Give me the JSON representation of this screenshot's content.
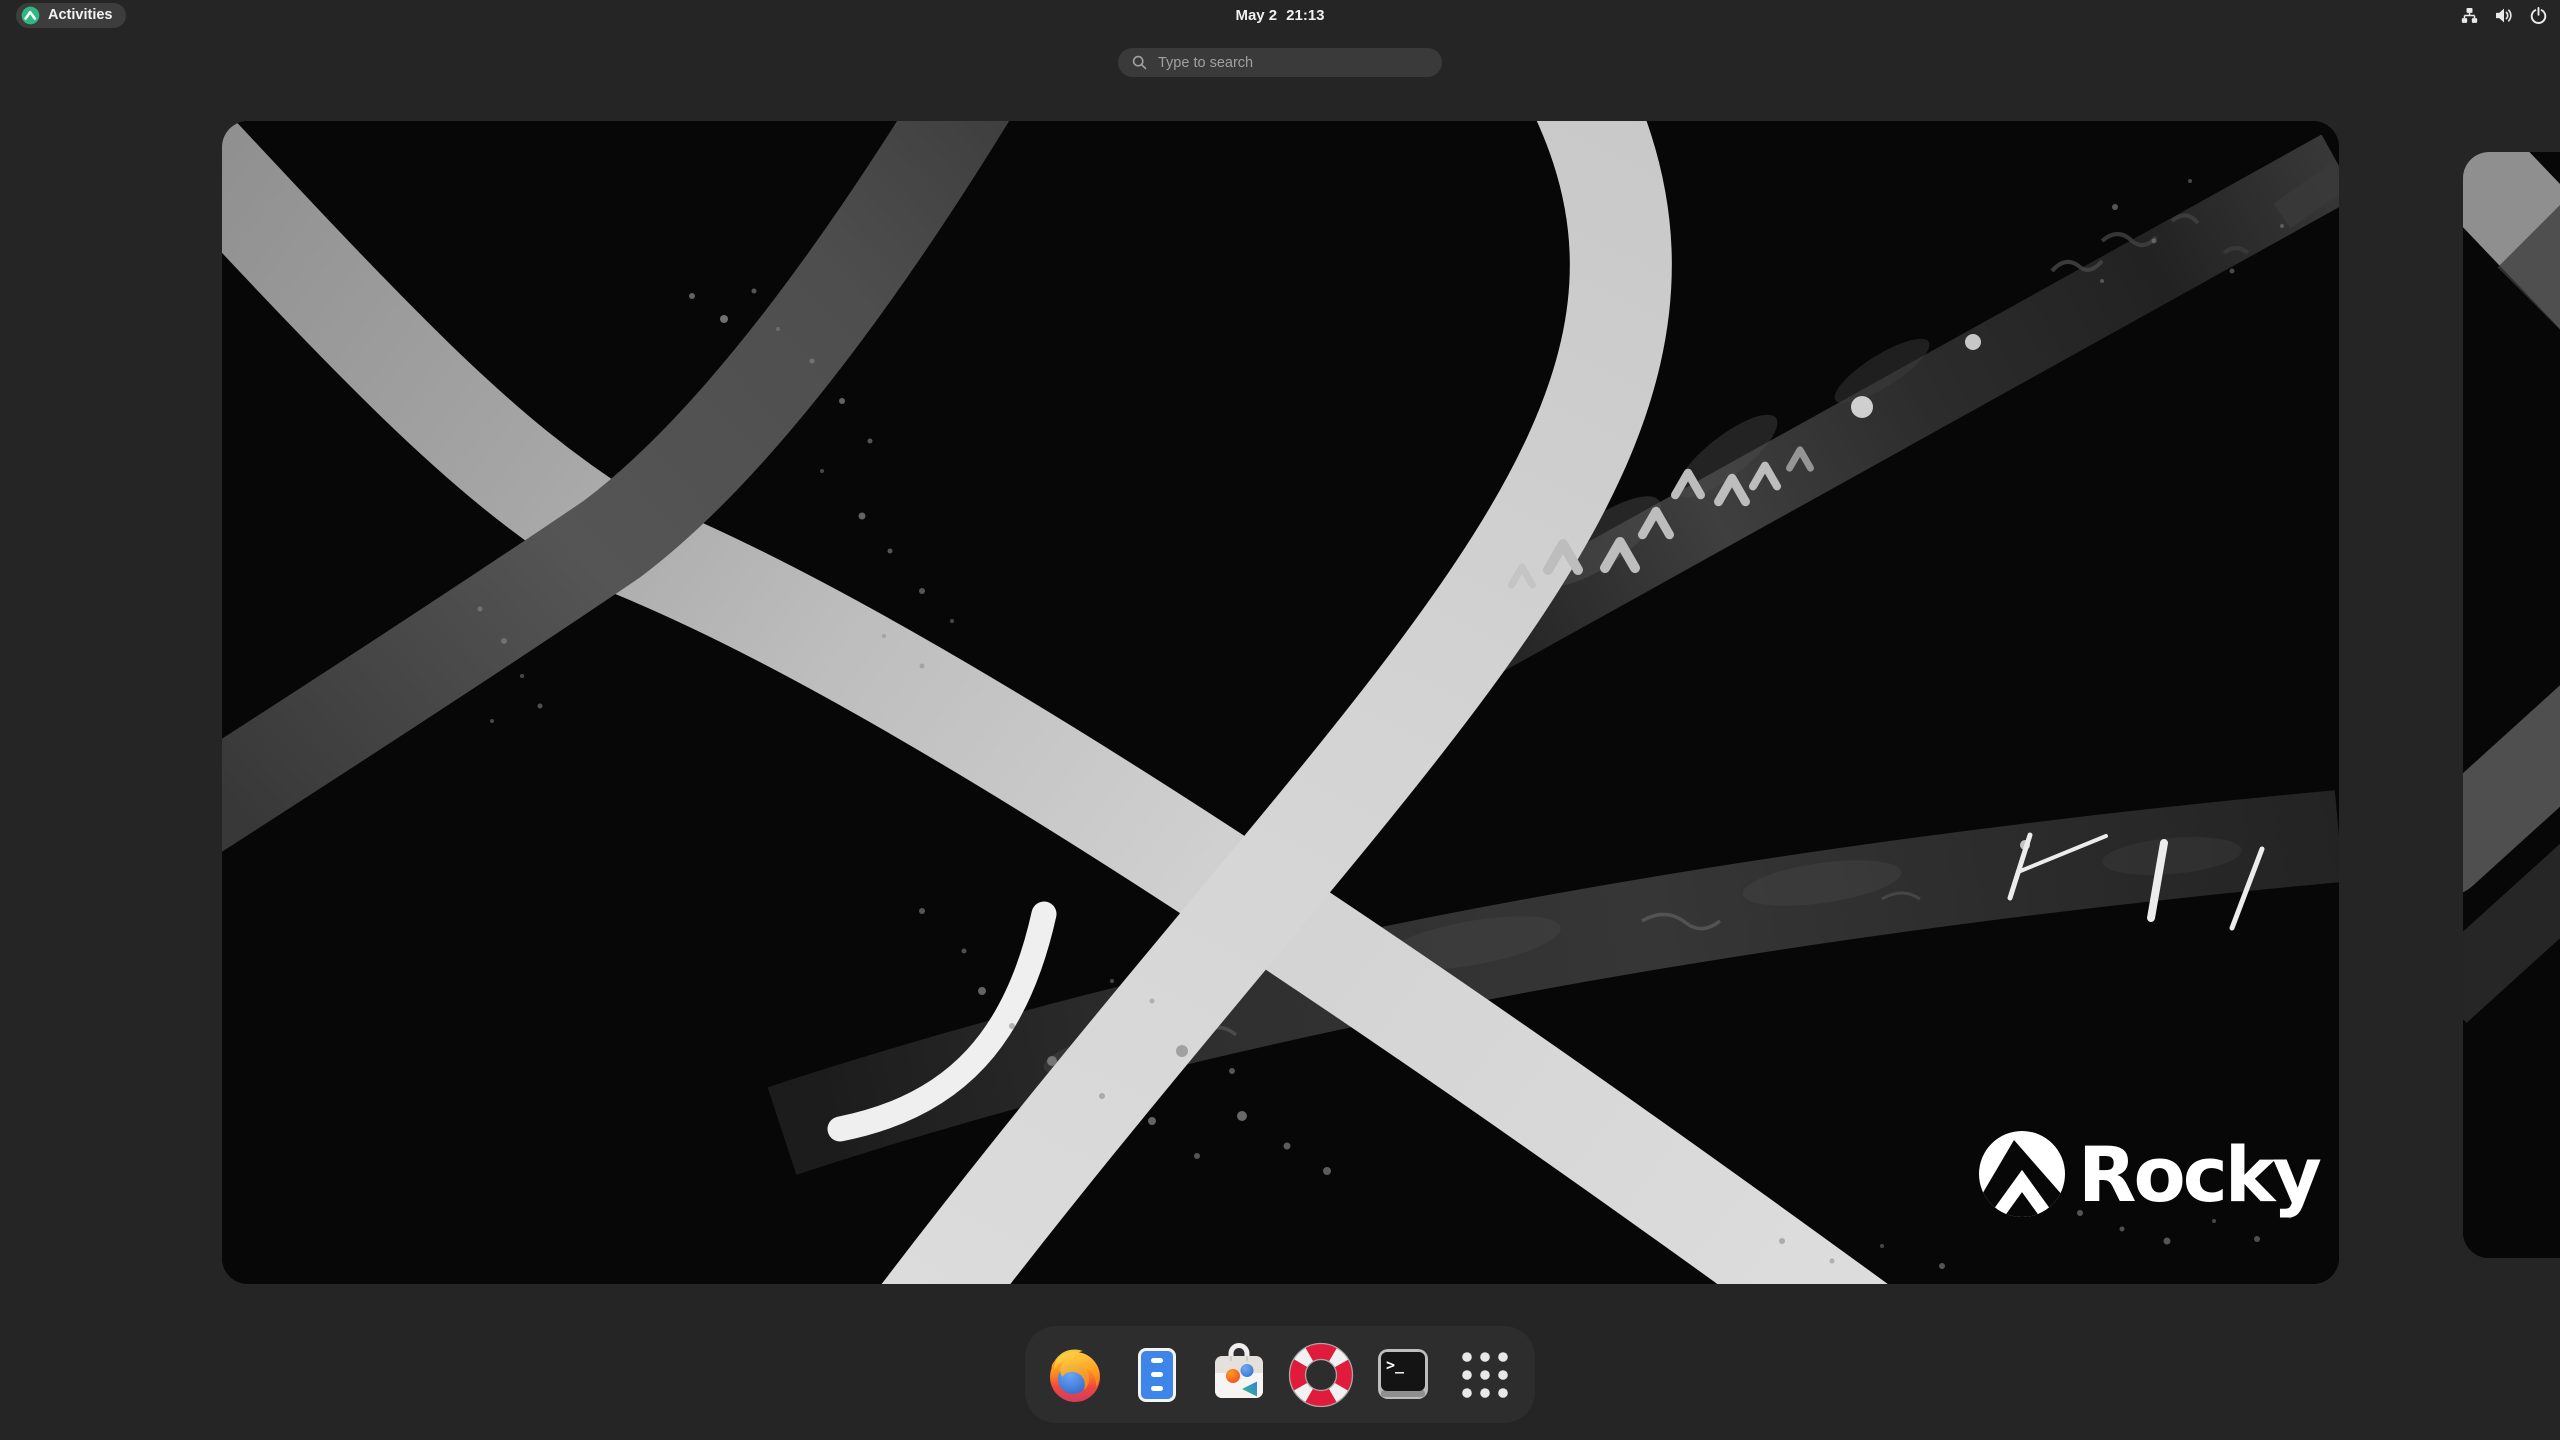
{
  "top_bar": {
    "activities_label": "Activities",
    "clock_date": "May 2",
    "clock_time": "21:13",
    "status_icons": [
      "network-wired",
      "volume-high",
      "power"
    ]
  },
  "search": {
    "placeholder": "Type to search"
  },
  "workspaces": {
    "brand_text": "Rocky"
  },
  "dock": {
    "items": [
      {
        "name": "firefox"
      },
      {
        "name": "files"
      },
      {
        "name": "software"
      },
      {
        "name": "help"
      },
      {
        "name": "terminal"
      },
      {
        "name": "show-apps"
      }
    ]
  },
  "colors": {
    "background": "#252525",
    "top_bar_pill": "#3d3d3d",
    "search_field": "#3a3a3a",
    "dock_background": "#2d2d2d",
    "accent_teal": "#2eb885",
    "wallpaper_black": "#070707",
    "help_red": "#e01b3c",
    "files_blue": "#3d85e8",
    "brand_white": "#ffffff"
  }
}
